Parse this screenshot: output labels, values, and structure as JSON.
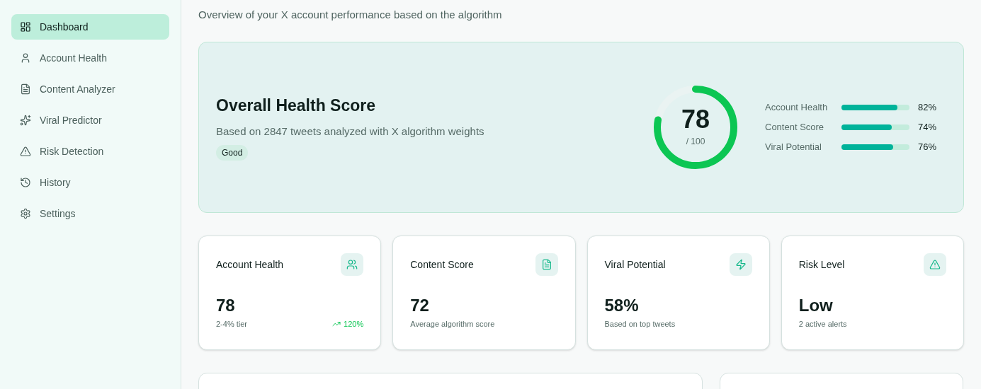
{
  "sidebar": {
    "items": [
      {
        "label": "Dashboard",
        "kind": "dashboard",
        "selected": true
      },
      {
        "label": "Account Health",
        "kind": "user",
        "selected": false
      },
      {
        "label": "Content Analyzer",
        "kind": "file",
        "selected": false
      },
      {
        "label": "Viral Predictor",
        "kind": "sparkles",
        "selected": false
      },
      {
        "label": "Risk Detection",
        "kind": "alert",
        "selected": false
      },
      {
        "label": "History",
        "kind": "history",
        "selected": false
      },
      {
        "label": "Settings",
        "kind": "settings",
        "selected": false
      }
    ]
  },
  "subtitle": "Overview of your X account performance based on the algorithm",
  "health": {
    "title": "Overall Health Score",
    "description": "Based on 2847 tweets analyzed with X algorithm weights",
    "badge": "Good",
    "score": "78",
    "max": "/ 100",
    "level": 0.78,
    "metrics": [
      {
        "label": "Account Health",
        "level": 0.82,
        "reading": "82%"
      },
      {
        "label": "Content Score",
        "level": 0.74,
        "reading": "74%"
      },
      {
        "label": "Viral Potential",
        "level": 0.76,
        "reading": "76%"
      }
    ]
  },
  "stats": [
    {
      "title": "Account Health",
      "kind": "users",
      "value": "78",
      "caption": "2-4% tier",
      "trend": "120%"
    },
    {
      "title": "Content Score",
      "kind": "file",
      "value": "72",
      "caption": "Average algorithm score"
    },
    {
      "title": "Viral Potential",
      "kind": "zap",
      "value": "58%",
      "caption": "Based on top tweets"
    },
    {
      "title": "Risk Level",
      "kind": "alert",
      "value": "Low",
      "caption": "2 active alerts"
    }
  ]
}
